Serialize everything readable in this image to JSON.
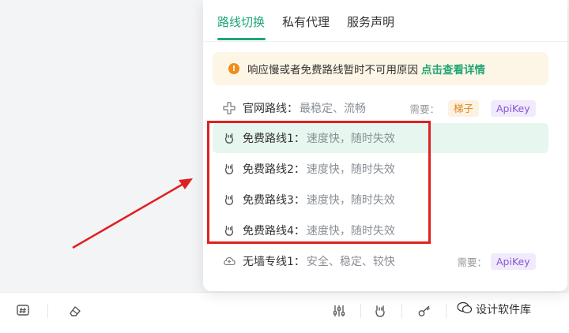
{
  "tabs": [
    {
      "label": "路线切换",
      "active": true
    },
    {
      "label": "私有代理",
      "active": false
    },
    {
      "label": "服务声明",
      "active": false
    }
  ],
  "notice": {
    "text": "响应慢或者免费路线暂时不可用原因",
    "link": "点击查看详情",
    "icon": "warning-icon"
  },
  "routes": {
    "official": {
      "name": "官网路线：",
      "desc": "最稳定、流畅",
      "require_label": "需要：",
      "tags": [
        "梯子",
        "ApiKey"
      ]
    },
    "free1": {
      "name": "免费路线1：",
      "desc": "速度快，随时失效",
      "selected": true
    },
    "free2": {
      "name": "免费路线2：",
      "desc": "速度快，随时失效"
    },
    "free3": {
      "name": "免费路线3：",
      "desc": "速度快，随时失效"
    },
    "free4": {
      "name": "免费路线4：",
      "desc": "速度快，随时失效"
    },
    "nowall": {
      "name": "无墙专线1：",
      "desc": "安全、稳定、较快",
      "require_label": "需要：",
      "tags": [
        "ApiKey"
      ]
    }
  },
  "watermark": {
    "account": "设计软件库"
  },
  "colors": {
    "accent": "#21a675",
    "warning": "#f08c1a",
    "highlight": "#e02020",
    "apikey": "#8a55d6",
    "ladder": "#e0851f"
  }
}
